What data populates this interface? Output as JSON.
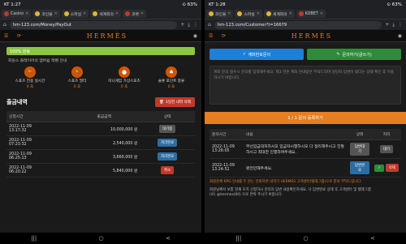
{
  "left": {
    "status": {
      "time": "KT 1:27",
      "right": "⊙ 63%"
    },
    "tabs": [
      {
        "label": "Casino"
      },
      {
        "label": "코인블"
      },
      {
        "label": "스파실"
      },
      {
        "label": "세계회의"
      },
      {
        "label": "코벳"
      }
    ],
    "url": "hm-123.com/Money/PayOut",
    "header": {
      "logo": "HERMÈS"
    },
    "progress": {
      "label": "100% 완료",
      "percent": 100
    },
    "level_note": "회원스 플레이어의 멤버쉽 레벨 안내",
    "levels": [
      {
        "name": "스포츠 전용 실시간",
        "points": "0 포"
      },
      {
        "name": "스포츠 멀티",
        "points": "0 포"
      },
      {
        "name": "미니게임 가상스포츠",
        "points": "0 포"
      },
      {
        "name": "슬롯 포인트 충류",
        "points": "0 포"
      }
    ],
    "section_title": "출금내역",
    "delete_btn": "3일전 내역 삭제",
    "table": {
      "headers": [
        "신청시간",
        "출금금액",
        "상태"
      ],
      "rows": [
        {
          "date": "2022-11-09",
          "time": "13:17:32",
          "amount": "10,000,000 원",
          "status": "대기중",
          "kind": "wait"
        },
        {
          "date": "2022-11-09",
          "time": "07:23:32",
          "amount": "2,540,000 원",
          "status": "처리완료",
          "kind": "done"
        },
        {
          "date": "2022-11-09",
          "time": "06:25:13",
          "amount": "3,660,000 원",
          "status": "처리완료",
          "kind": "done"
        },
        {
          "date": "2022-11-09",
          "time": "06:20:22",
          "amount": "5,840,000 원",
          "status": "취소",
          "kind": "cancel"
        }
      ]
    },
    "nav": [
      "|||",
      "○",
      "<"
    ]
  },
  "right": {
    "status": {
      "time": "KT 1:28",
      "right": "⊙ 63%"
    },
    "tabs": [
      {
        "label": "코인블"
      },
      {
        "label": "스파실"
      },
      {
        "label": "세계회의"
      },
      {
        "label": "KOBET"
      }
    ],
    "url": "hm-123.com/Customer?t=16679",
    "header": {
      "logo": "HERMÈS"
    },
    "buttons": {
      "account": "계좌번호문의",
      "write": "문의하기(글쓰기)"
    },
    "textarea_placeholder": "계좌 문의 접수시 문의를 입력해주세요. 제3 잔은 계좌 안내받은 부탁드리며 담당자 답변이 왔다는 상태 확인 후 이용하시기 바랍니다.",
    "submit": "1 / 1 문의 등록하기",
    "table": {
      "headers": [
        "문의시간",
        "내용",
        "상태",
        "처리"
      ],
      "rows": [
        {
          "date": "2022-11-09",
          "time": "13:26:05",
          "content": "무선입금대처하시오 입금자시행하시오 다 정리해주시고 친절하시고 최대한 진행하여주세요.",
          "status": "답변대기",
          "action": "대기"
        },
        {
          "date": "2022-11-09",
          "time": "13:24:52",
          "content": "환전만해주세요.",
          "status": "답변완료",
          "action": "삭제"
        }
      ]
    },
    "notice_lines": [
      "회원분께 RPG 안내를 두 분는 전화하면 내역기 HERMES 고객센터(텔레그램)으로 문의 부탁드립니다.",
      "회원님께서 보통 현재 조치 신청하시 관리자 답변 내용확인하세요. 나 답변완료 상태 후 고객센터 및 텔레그램",
      "(로) @hermes(00) 으로 연락 주시기 바랍니다."
    ],
    "nav": [
      "|||",
      "○",
      "<"
    ]
  }
}
